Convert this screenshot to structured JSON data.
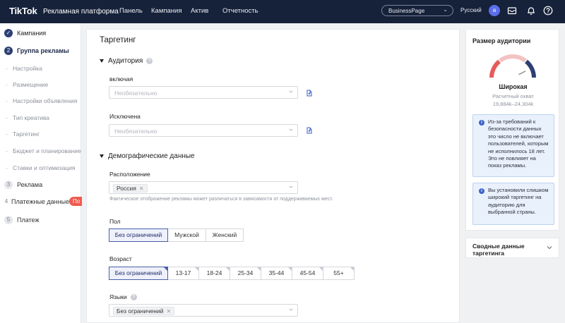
{
  "topbar": {
    "logo": "TikTok",
    "logo_suffix": "Рекламная платформа",
    "nav": [
      "Панель",
      "Кампания",
      "Актив",
      "Отчетность"
    ],
    "account": "BusinessPage",
    "language": "Русский",
    "avatar_letter": "a"
  },
  "sidebar": {
    "steps": [
      {
        "label": "Кампания",
        "state": "done"
      },
      {
        "num": "2",
        "label": "Группа рекламы",
        "state": "active"
      },
      {
        "num": "3",
        "label": "Реклама",
        "state": "todo"
      },
      {
        "num": "4",
        "label": "Платежные данные",
        "state": "todo",
        "badge": "По"
      },
      {
        "num": "5",
        "label": "Платеж",
        "state": "todo"
      }
    ],
    "substeps": [
      "Настройка",
      "Размещение",
      "Настройки объявления",
      "Тип креатива",
      "Таргетинг",
      "Бюджет и планирование",
      "Ставки и оптимизация"
    ]
  },
  "main": {
    "title": "Таргетинг",
    "audience": {
      "title": "Аудитория",
      "include_label": "включая",
      "include_placeholder": "Необязательно",
      "exclude_label": "Исключена",
      "exclude_placeholder": "Необязательно"
    },
    "demographics": {
      "title": "Демографические данные",
      "location_label": "Расположение",
      "location_tag": "Россия",
      "location_hint": "Фактическое отображение рекламы может различаться в зависимости от поддерживаемых мест.",
      "gender_label": "Пол",
      "gender_options": [
        "Без ограничений",
        "Мужской",
        "Женский"
      ],
      "gender_selected": 0,
      "age_label": "Возраст",
      "age_options": [
        "Без ограничений",
        "13-17",
        "18-24",
        "25-34",
        "35-44",
        "45-54",
        "55+"
      ],
      "age_selected": 0,
      "lang_label": "Языки",
      "lang_tag": "Без ограничений"
    }
  },
  "audience_size": {
    "title": "Размер аудитории",
    "status": "Широкая",
    "reach_label": "Расчетный охват",
    "reach_value": "19,884k–24,304k",
    "note1": "Из-за требований к безопасности данных это число не включает пользователей, которым не исполнилось 18 лет. Это не повлияет на показ рекламы.",
    "note2": "Вы установили слишком широкий таргетинг на аудиторию для выбранной страны.",
    "gauge_level": 0.85,
    "colors": {
      "low": "#e85a5a",
      "mid": "#f3c2c2",
      "high": "#2d3f73"
    }
  },
  "summary": {
    "title": "Сводные данные таргетинга"
  }
}
